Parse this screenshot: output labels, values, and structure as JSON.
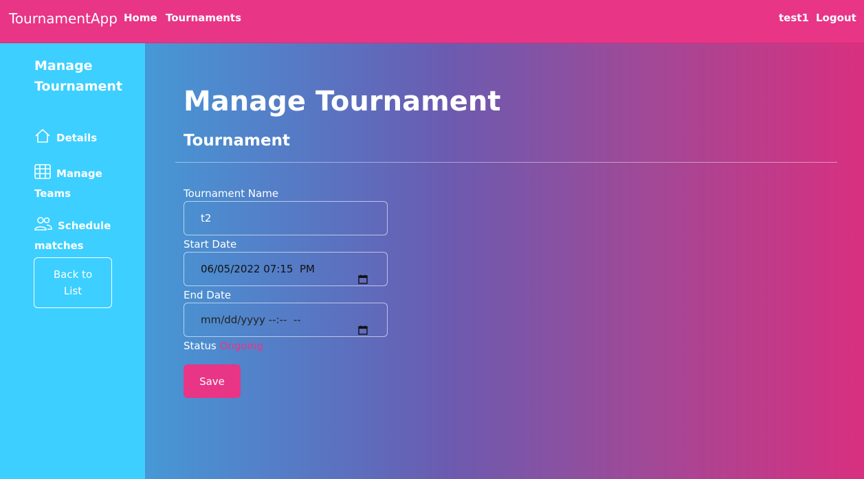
{
  "navbar": {
    "brand": "TournamentApp",
    "links": [
      "Home",
      "Tournaments"
    ],
    "user": "test1",
    "logout": "Logout"
  },
  "sidebar": {
    "title": "Manage Tournament",
    "items": [
      {
        "label": "Details",
        "icon": "home-icon"
      },
      {
        "label": "Manage Teams",
        "icon": "table-icon"
      },
      {
        "label": "Schedule matches",
        "icon": "people-icon"
      }
    ],
    "back_button": "Back to List"
  },
  "main": {
    "page_title": "Manage Tournament",
    "section_title": "Tournament",
    "fields": {
      "name_label": "Tournament Name",
      "name_value": "t2",
      "start_label": "Start Date",
      "start_value": "06/05/2022 07:15  PM",
      "end_label": "End Date",
      "end_value": "mm/dd/yyyy --:--  --"
    },
    "status_label": "Status",
    "status_value": "Ongoing",
    "save_button": "Save"
  },
  "colors": {
    "primary": "#e83586",
    "sidebar": "#3ccfff"
  }
}
